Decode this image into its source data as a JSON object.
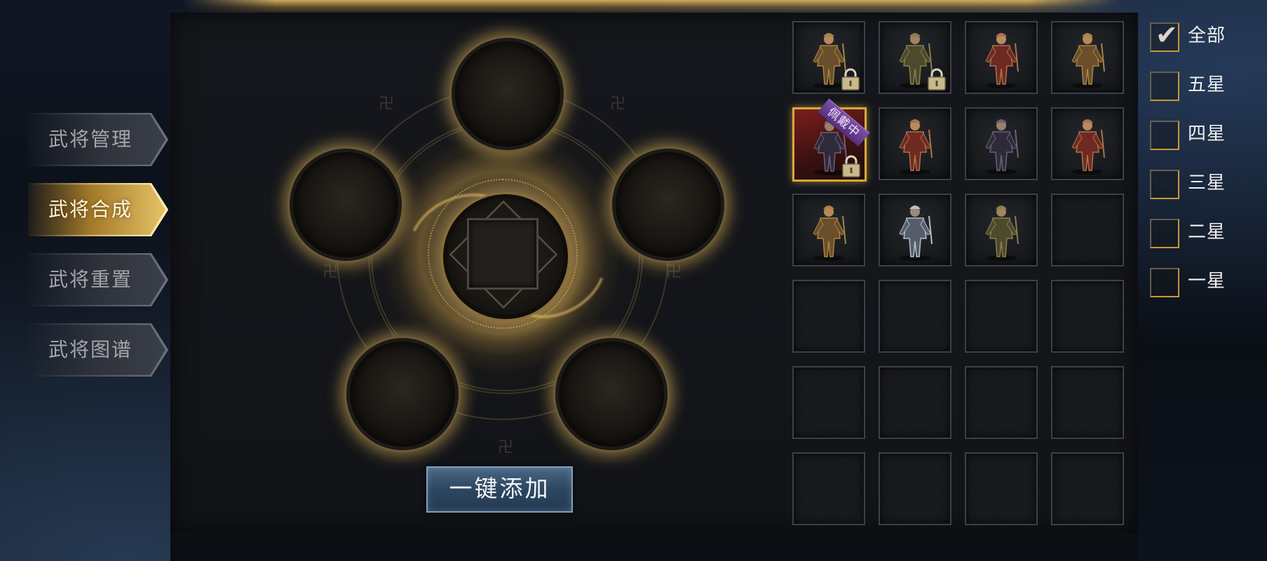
{
  "menu": {
    "items": [
      {
        "label": "武将管理",
        "active": false
      },
      {
        "label": "武将合成",
        "active": true
      },
      {
        "label": "武将重置",
        "active": false
      },
      {
        "label": "武将图谱",
        "active": false
      }
    ]
  },
  "synthesis": {
    "add_button_label": "一键添加"
  },
  "hero_grid": {
    "equipped_tag": "佩戴中",
    "cells": [
      {
        "state": "hero",
        "locked": true,
        "selected": false,
        "equipped": false,
        "palette": "bronze"
      },
      {
        "state": "hero",
        "locked": true,
        "selected": false,
        "equipped": false,
        "palette": "olive"
      },
      {
        "state": "hero",
        "locked": false,
        "selected": false,
        "equipped": false,
        "palette": "red"
      },
      {
        "state": "hero",
        "locked": false,
        "selected": false,
        "equipped": false,
        "palette": "bronze"
      },
      {
        "state": "hero",
        "locked": true,
        "selected": true,
        "equipped": true,
        "palette": "dark"
      },
      {
        "state": "hero",
        "locked": false,
        "selected": false,
        "equipped": false,
        "palette": "red"
      },
      {
        "state": "hero",
        "locked": false,
        "selected": false,
        "equipped": false,
        "palette": "dark"
      },
      {
        "state": "hero",
        "locked": false,
        "selected": false,
        "equipped": false,
        "palette": "red"
      },
      {
        "state": "hero",
        "locked": false,
        "selected": false,
        "equipped": false,
        "palette": "bronze"
      },
      {
        "state": "hero",
        "locked": false,
        "selected": false,
        "equipped": false,
        "palette": "steel"
      },
      {
        "state": "hero",
        "locked": false,
        "selected": false,
        "equipped": false,
        "palette": "olive"
      },
      {
        "state": "empty"
      },
      {
        "state": "empty"
      },
      {
        "state": "empty"
      },
      {
        "state": "empty"
      },
      {
        "state": "empty"
      },
      {
        "state": "empty"
      },
      {
        "state": "empty"
      },
      {
        "state": "empty"
      },
      {
        "state": "empty"
      },
      {
        "state": "empty"
      },
      {
        "state": "empty"
      },
      {
        "state": "empty"
      },
      {
        "state": "empty"
      }
    ]
  },
  "filter": {
    "options": [
      {
        "label": "全部",
        "checked": true
      },
      {
        "label": "五星",
        "checked": false
      },
      {
        "label": "四星",
        "checked": false
      },
      {
        "label": "三星",
        "checked": false
      },
      {
        "label": "二星",
        "checked": false
      },
      {
        "label": "一星",
        "checked": false
      }
    ]
  },
  "colors": {
    "gold_accent": "#d6a93f",
    "button_blue": "#2d4660",
    "panel": "#15171c"
  }
}
